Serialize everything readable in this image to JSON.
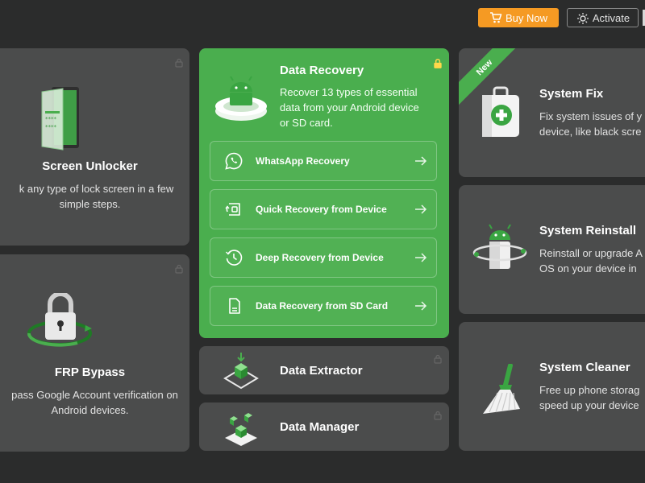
{
  "topbar": {
    "buy_now": "Buy Now",
    "activate": "Activate"
  },
  "colors": {
    "background": "#2b2c2c",
    "card": "#4b4c4c",
    "accent_green": "#4aae4e",
    "buy_orange": "#f59a23"
  },
  "cards": {
    "screen_unlocker": {
      "title": "Screen Unlocker",
      "desc_line1": "k any type of lock screen in a few",
      "desc_line2": "simple steps.",
      "icon": "phone-unlock-icon"
    },
    "frp_bypass": {
      "title": "FRP Bypass",
      "desc_line1": "pass Google Account verification on",
      "desc_line2": "Android devices.",
      "icon": "padlock-icon"
    },
    "data_recovery": {
      "title": "Data Recovery",
      "desc_line1": "Recover 13 types of essential",
      "desc_line2": "data from your Android device",
      "desc_line3": "or SD card.",
      "icon": "android-platform-icon",
      "items": [
        {
          "label": "WhatsApp Recovery",
          "icon": "whatsapp-icon"
        },
        {
          "label": "Quick Recovery from Device",
          "icon": "quick-recovery-icon"
        },
        {
          "label": "Deep Recovery from Device",
          "icon": "deep-recovery-icon"
        },
        {
          "label": "Data Recovery from SD Card",
          "icon": "sd-card-icon"
        }
      ]
    },
    "data_extractor": {
      "title": "Data Extractor",
      "icon": "extractor-cube-icon"
    },
    "data_manager": {
      "title": "Data Manager",
      "icon": "manager-cubes-icon"
    },
    "system_fix": {
      "badge": "New",
      "title": "System Fix",
      "desc_line1": "Fix system issues of y",
      "desc_line2": "device, like black scre",
      "icon": "first-aid-kit-icon"
    },
    "system_reinstall": {
      "title": "System Reinstall",
      "desc_line1": "Reinstall or upgrade A",
      "desc_line2": "OS on your device in",
      "icon": "android-robot-icon"
    },
    "system_cleaner": {
      "title": "System Cleaner",
      "desc_line1": "Free up phone storag",
      "desc_line2": "speed up your device",
      "icon": "broom-icon"
    }
  }
}
